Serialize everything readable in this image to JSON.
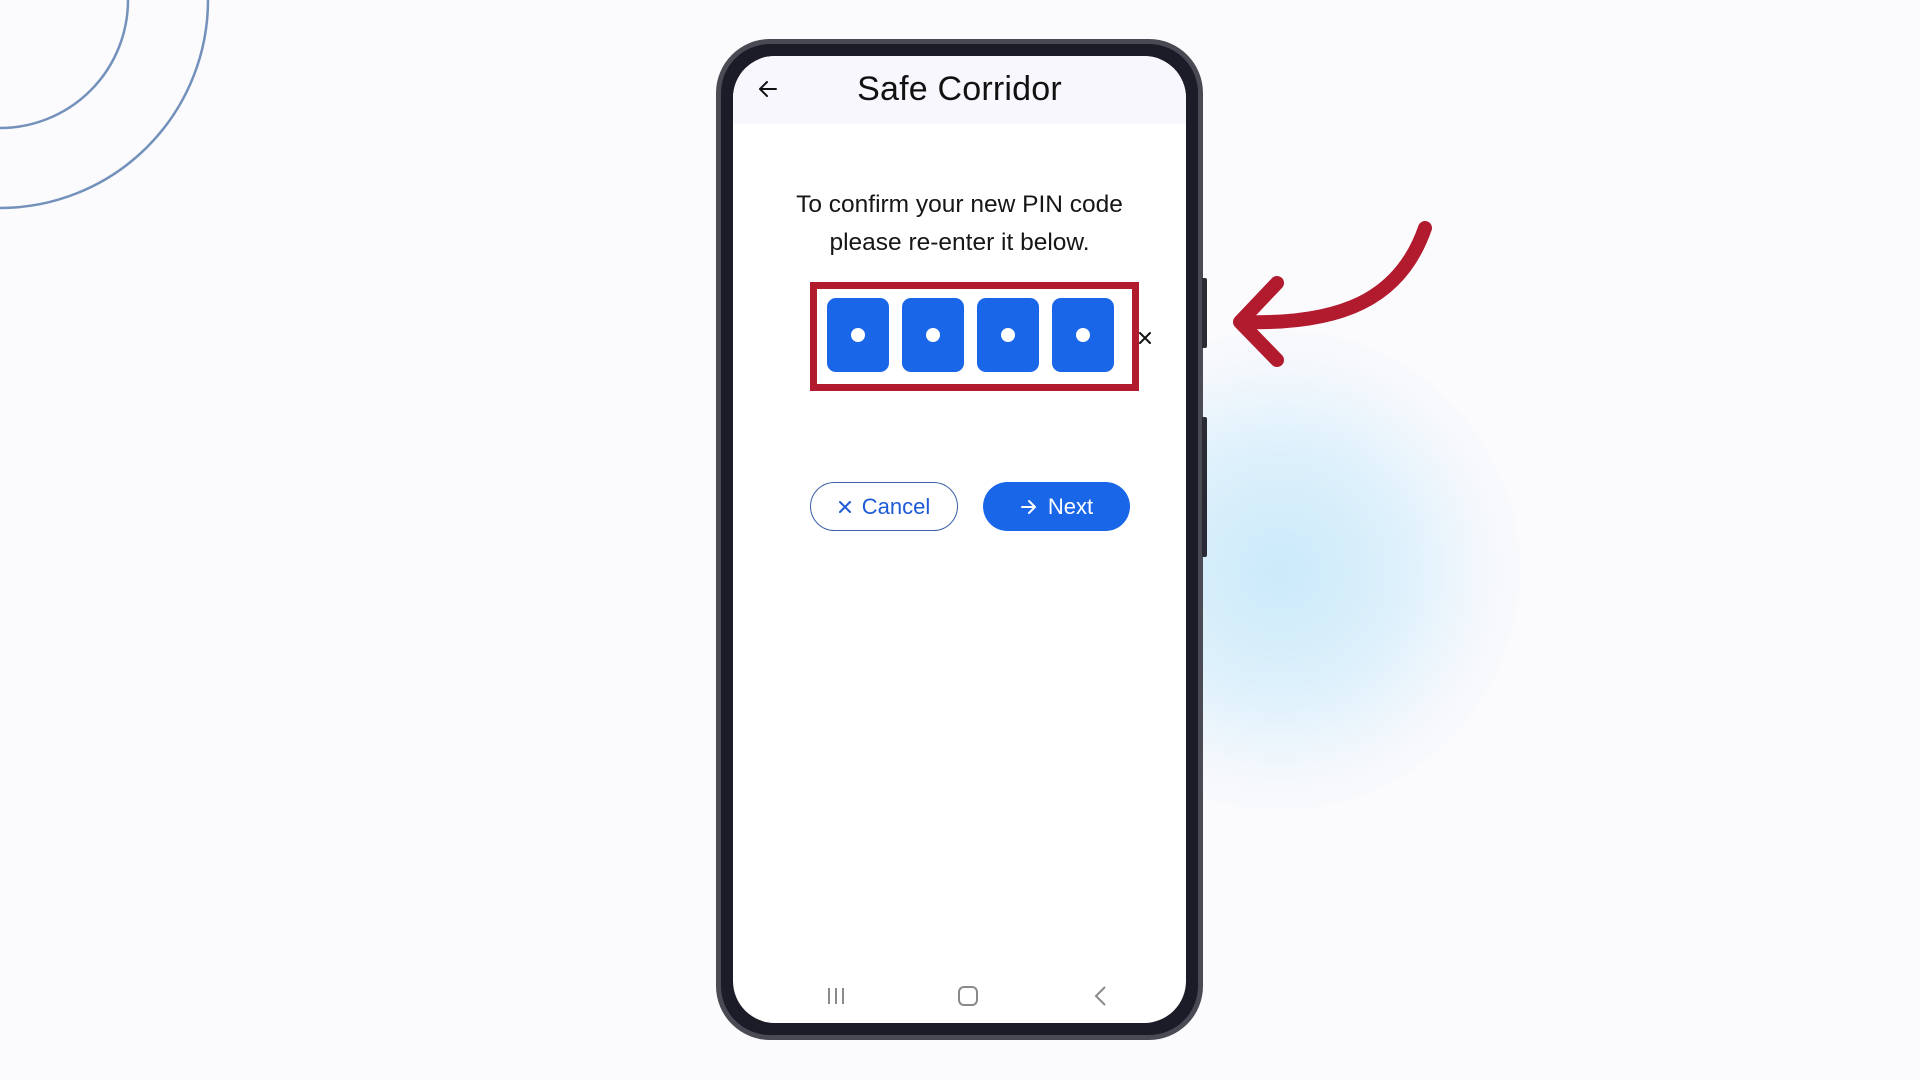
{
  "app": {
    "title": "Safe Corridor",
    "back_icon": "arrow-left-icon"
  },
  "pin_confirm": {
    "instructions_line1": "To confirm your new PIN code",
    "instructions_line2": "please re-enter it below.",
    "pin_length": 4,
    "digits_entered": 4,
    "masked_char": "•",
    "clear_icon": "close-icon"
  },
  "buttons": {
    "cancel": {
      "label": "Cancel",
      "icon": "close-icon"
    },
    "next": {
      "label": "Next",
      "icon": "arrow-right-icon"
    }
  },
  "system_nav": {
    "recents_icon": "recents-icon",
    "home_icon": "home-icon",
    "back_icon": "chevron-left-icon"
  },
  "annotation": {
    "highlight_color": "#b21a2e",
    "arrow_color": "#b21a2e",
    "target": "pin-input"
  },
  "colors": {
    "primary": "#1a66e8",
    "background": "#fbfafd",
    "header_bg": "#f8f7fd"
  }
}
